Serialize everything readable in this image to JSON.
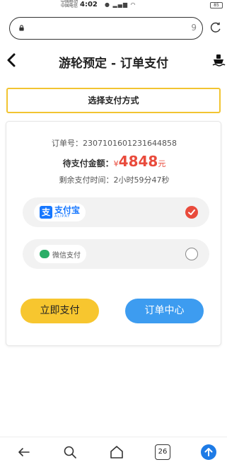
{
  "status_bar": {
    "carrier_lines": [
      "中国移动",
      "中国电信"
    ],
    "time": "4:02",
    "battery": "85"
  },
  "browser": {
    "url_bar_text": "9",
    "icons": [
      "lock-icon",
      "refresh-icon"
    ]
  },
  "header": {
    "back_icon": "chevron-left-icon",
    "title": "游轮预定 - 订单支付",
    "right_icon": "ship-icon"
  },
  "section": {
    "title": "选择支付方式"
  },
  "order": {
    "order_no_label": "订单号：",
    "order_no": "2307101601231644858",
    "amount_label": "待支付金额：",
    "currency": "¥",
    "amount": "4848",
    "amount_unit": "元",
    "time_label": "剩余支付时间：",
    "time_remaining": "2小时59分47秒"
  },
  "payment_methods": [
    {
      "name_cn": "支付宝",
      "name_en": "ALIPAY",
      "logo_mark": "支",
      "selected": true
    },
    {
      "name_cn": "微信支付",
      "selected": false
    }
  ],
  "buttons": {
    "pay_now": "立即支付",
    "order_center": "订单中心"
  },
  "bottom_nav": {
    "tab_count": "26",
    "items": [
      "back-arrow-icon",
      "search-icon",
      "home-icon",
      "tabs-icon",
      "upload-icon"
    ]
  },
  "colors": {
    "accent_yellow": "#f7c62f",
    "accent_blue": "#3d9cf0",
    "price_red": "#e94b3c",
    "alipay_blue": "#1677ff",
    "wechat_green": "#2aae67"
  }
}
